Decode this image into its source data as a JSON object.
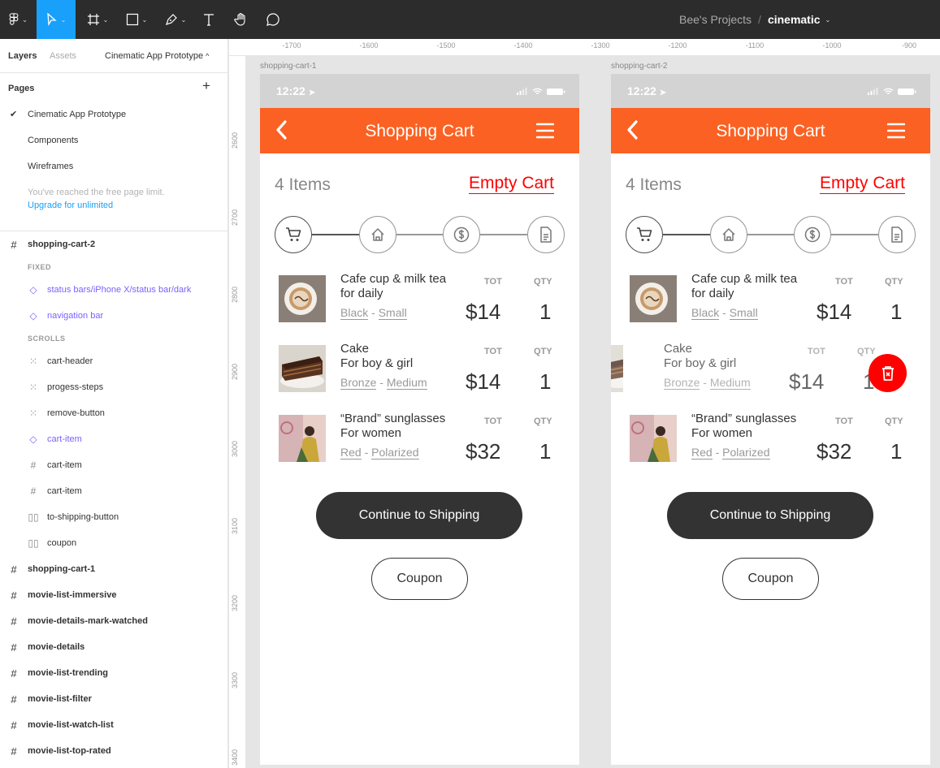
{
  "toolbar": {
    "project": "Bee's Projects",
    "separator": "/",
    "file": "cinematic"
  },
  "sidebar": {
    "tab_layers": "Layers",
    "tab_assets": "Assets",
    "current_page": "Cinematic App Prototype",
    "pages_title": "Pages",
    "pages": [
      "Cinematic App Prototype",
      "Components",
      "Wireframes"
    ],
    "page_limit_note": "You've reached the free page limit.",
    "upgrade_link": "Upgrade for unlimited",
    "layers": {
      "frame": "shopping-cart-2",
      "fixed_label": "FIXED",
      "fixed": [
        "status bars/iPhone X/status bar/dark",
        "navigation bar"
      ],
      "scrolls_label": "SCROLLS",
      "scrolls": [
        "cart-header",
        "progess-steps",
        "remove-button",
        "cart-item",
        "cart-item",
        "cart-item",
        "to-shipping-button",
        "coupon"
      ],
      "frames": [
        "shopping-cart-1",
        "movie-list-immersive",
        "movie-details-mark-watched",
        "movie-details",
        "movie-list-trending",
        "movie-list-filter",
        "movie-list-watch-list",
        "movie-list-top-rated"
      ]
    }
  },
  "ruler": {
    "top": [
      "-1700",
      "-1600",
      "-1500",
      "-1400",
      "-1300",
      "-1200",
      "-1100",
      "-1000",
      "-900"
    ],
    "left": [
      "2600",
      "2700",
      "2800",
      "2900",
      "3000",
      "3100",
      "3200",
      "3300",
      "3400"
    ]
  },
  "frames": [
    {
      "label": "shopping-cart-1"
    },
    {
      "label": "shopping-cart-2"
    }
  ],
  "app": {
    "status_time": "12:22",
    "nav_title": "Shopping Cart",
    "items_count": "4 Items",
    "empty_cart": "Empty Cart",
    "tot_label": "TOT",
    "qty_label": "QTY",
    "items": [
      {
        "name1": "Cafe cup & milk tea",
        "name2": "for daily",
        "color": "Black",
        "size": "Small",
        "price": "$14",
        "qty": "1"
      },
      {
        "name1": "Cake",
        "name2": "For boy & girl",
        "color": "Bronze",
        "size": "Medium",
        "price": "$14",
        "qty": "1"
      },
      {
        "name1": "“Brand” sunglasses",
        "name2": "For women",
        "color": "Red",
        "size": "Polarized",
        "price": "$32",
        "qty": "1"
      }
    ],
    "dash": "-",
    "continue_button": "Continue to Shipping",
    "coupon_button": "Coupon"
  },
  "colors": {
    "accent": "#fb6122",
    "danger": "#ff0000",
    "dark_button": "#333333"
  }
}
